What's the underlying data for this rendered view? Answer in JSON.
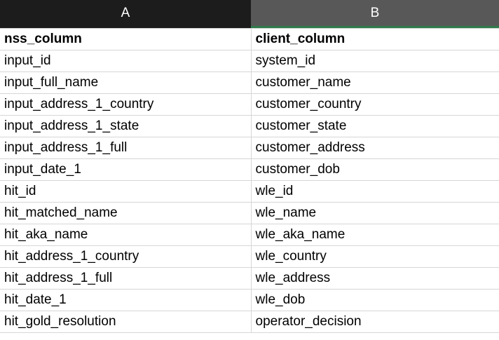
{
  "columns": [
    {
      "letter": "A"
    },
    {
      "letter": "B"
    }
  ],
  "header_row": {
    "a": "nss_column",
    "b": "client_column"
  },
  "rows": [
    {
      "a": "input_id",
      "b": "system_id"
    },
    {
      "a": "input_full_name",
      "b": "customer_name"
    },
    {
      "a": "input_address_1_country",
      "b": "customer_country"
    },
    {
      "a": "input_address_1_state",
      "b": "customer_state"
    },
    {
      "a": "input_address_1_full",
      "b": "customer_address"
    },
    {
      "a": "input_date_1",
      "b": "customer_dob"
    },
    {
      "a": "hit_id",
      "b": "wle_id"
    },
    {
      "a": "hit_matched_name",
      "b": "wle_name"
    },
    {
      "a": "hit_aka_name",
      "b": "wle_aka_name"
    },
    {
      "a": "hit_address_1_country",
      "b": "wle_country"
    },
    {
      "a": "hit_address_1_full",
      "b": "wle_address"
    },
    {
      "a": "hit_date_1",
      "b": "wle_dob"
    },
    {
      "a": "hit_gold_resolution",
      "b": "operator_decision"
    }
  ],
  "colors": {
    "selected_column_header": "#1c1c1c",
    "column_header": "#585858",
    "selection_accent": "#2f7a4a",
    "gridline": "#d6d6d6"
  }
}
